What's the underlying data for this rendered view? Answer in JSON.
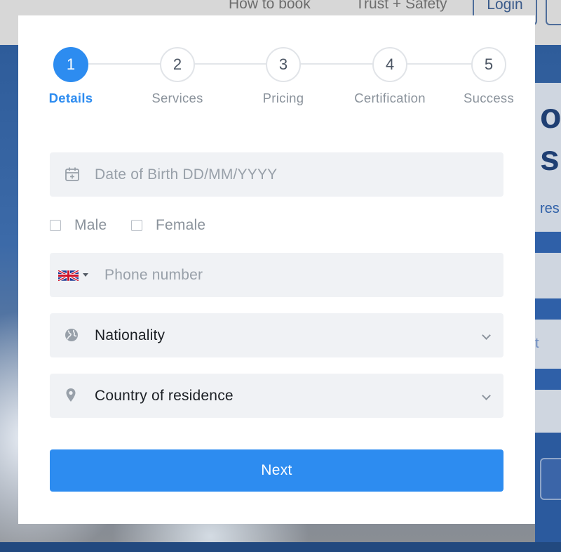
{
  "background_nav": {
    "links": [
      "How to book",
      "Trust + Safety"
    ],
    "login_label": "Login"
  },
  "background_hero": {
    "fragment_1": "o",
    "fragment_2": "s",
    "fragment_3": "res",
    "fragment_4": "t"
  },
  "steps": [
    {
      "number": "1",
      "label": "Details",
      "active": true
    },
    {
      "number": "2",
      "label": "Services",
      "active": false
    },
    {
      "number": "3",
      "label": "Pricing",
      "active": false
    },
    {
      "number": "4",
      "label": "Certification",
      "active": false
    },
    {
      "number": "5",
      "label": "Success",
      "active": false
    }
  ],
  "form": {
    "dob": {
      "placeholder": "Date of Birth DD/MM/YYYY",
      "icon": "calendar-icon"
    },
    "gender": {
      "options": [
        "Male",
        "Female"
      ]
    },
    "phone": {
      "placeholder": "Phone number",
      "country_icon": "uk-flag-icon"
    },
    "nationality": {
      "value": "Nationality",
      "icon": "globe-icon"
    },
    "residence": {
      "value": "Country of residence",
      "icon": "map-pin-icon"
    },
    "next_label": "Next"
  },
  "colors": {
    "accent": "#2d8cf0",
    "field_bg": "#f0f2f5",
    "placeholder": "#98a0a9"
  }
}
